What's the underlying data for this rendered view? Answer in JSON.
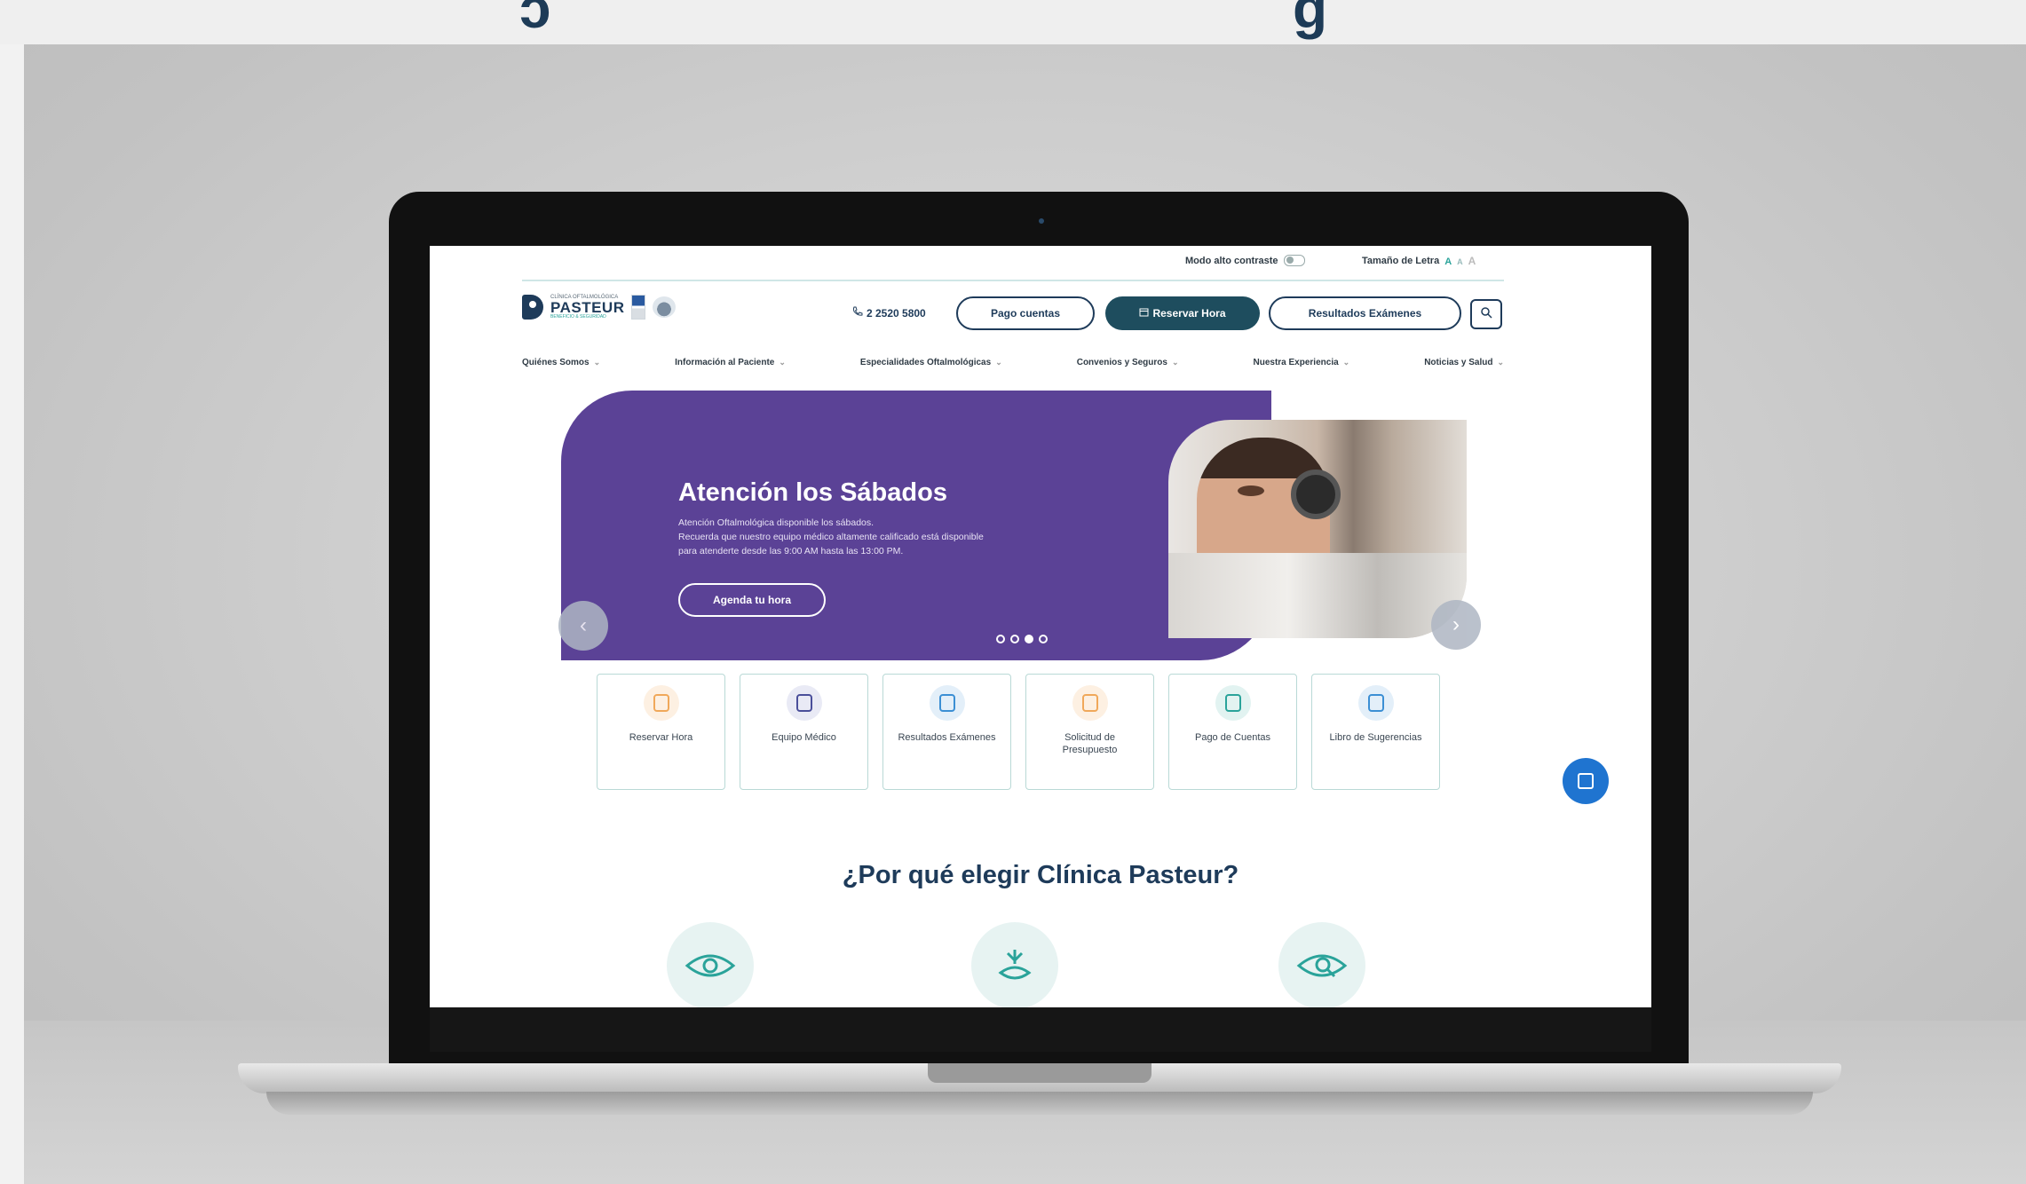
{
  "colors": {
    "brand_navy": "#1e3b5a",
    "hero_purple": "#5b4296",
    "accent_teal": "#2aa39a",
    "chat_blue": "#1f74d0"
  },
  "utility_bar": {
    "contrast_label": "Modo alto contraste",
    "font_size_label": "Tamaño de Letra",
    "font_sizes": [
      "A",
      "A",
      "A"
    ]
  },
  "logo": {
    "name": "PASTEUR",
    "small_text": "CLÍNICA OFTALMOLÓGICA",
    "sub_text": "BENEFICIO & SEGURIDAD"
  },
  "header": {
    "phone": "2 2520 5800",
    "pay_button": "Pago cuentas",
    "reserve_button": "Reservar Hora",
    "results_button": "Resultados Exámenes",
    "search_icon": "search-icon"
  },
  "nav": {
    "items": [
      {
        "label": "Quiénes Somos"
      },
      {
        "label": "Información al Paciente"
      },
      {
        "label": "Especialidades Oftalmológicas"
      },
      {
        "label": "Convenios y Seguros"
      },
      {
        "label": "Nuestra Experiencia"
      },
      {
        "label": "Noticias y Salud"
      }
    ]
  },
  "hero": {
    "title": "Atención los Sábados",
    "line1": "Atención Oftalmológica disponible los sábados.",
    "line2": "Recuerda que nuestro equipo médico altamente calificado está disponible",
    "line3": "para atenderte desde las 9:00 AM hasta las 13:00 PM.",
    "cta": "Agenda tu hora",
    "slides": 4,
    "active_slide": 3
  },
  "quick_links": [
    {
      "label": "Reservar Hora",
      "icon": "calendar-icon",
      "color": "#f0a85a"
    },
    {
      "label": "Equipo Médico",
      "icon": "clipboard-icon",
      "color": "#4a4f9a"
    },
    {
      "label": "Resultados Exámenes",
      "icon": "documents-icon",
      "color": "#3b8fd4"
    },
    {
      "label": "Solicitud de Presupuesto",
      "icon": "calculator-icon",
      "color": "#f0a85a"
    },
    {
      "label": "Pago de Cuentas",
      "icon": "bank-icon",
      "color": "#2aa39a"
    },
    {
      "label": "Libro de Sugerencias",
      "icon": "clipboard-check-icon",
      "color": "#3b8fd4"
    }
  ],
  "why": {
    "title": "¿Por qué elegir Clínica Pasteur?"
  }
}
